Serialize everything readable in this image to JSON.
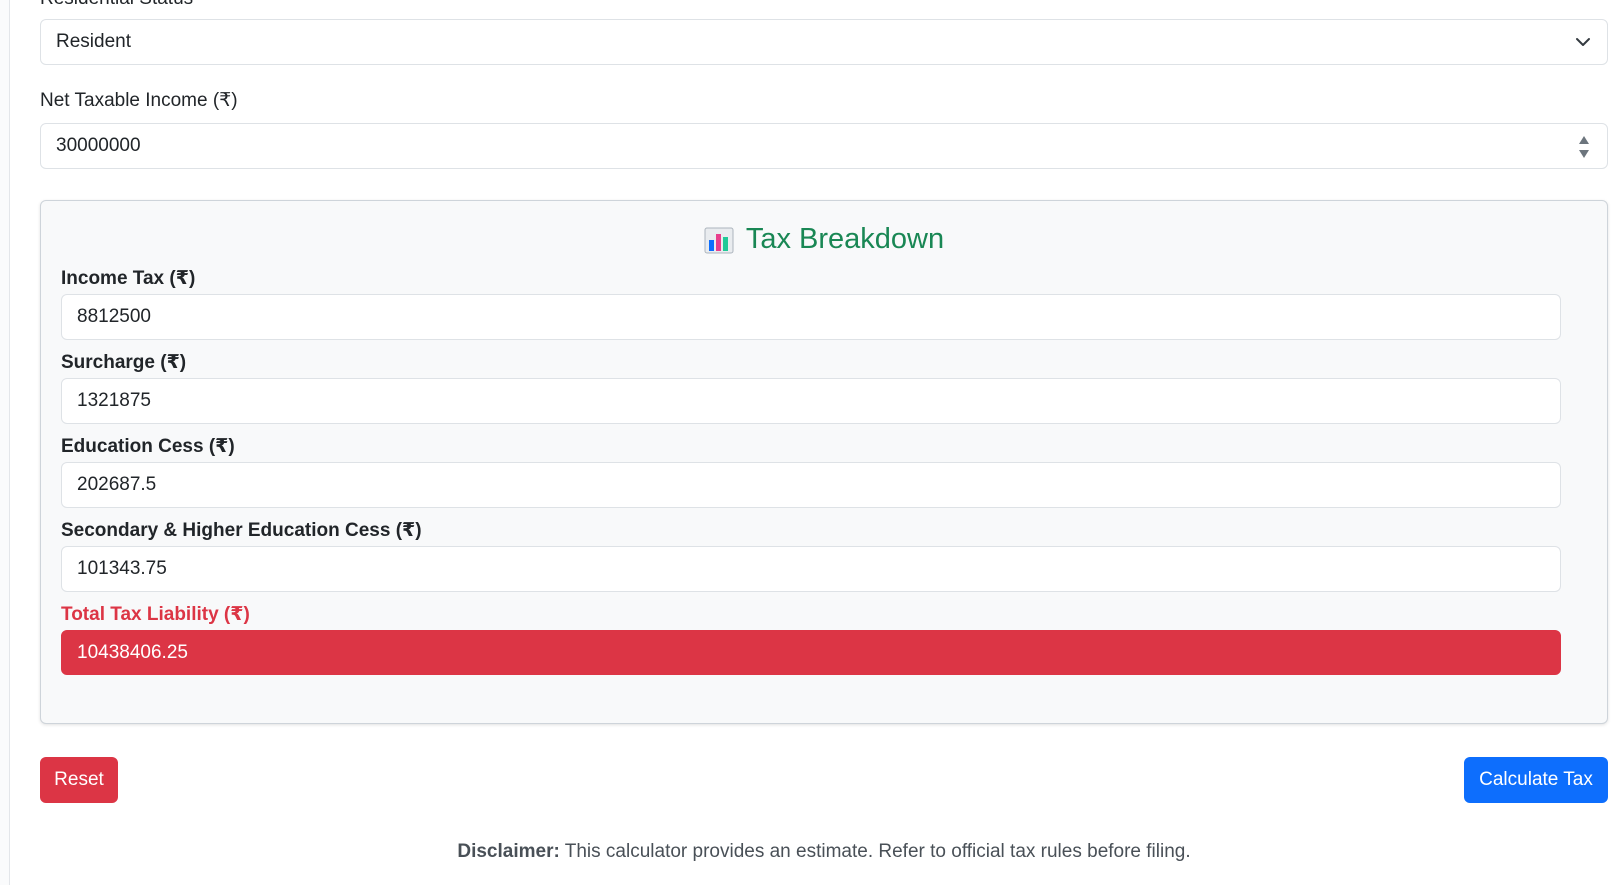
{
  "form": {
    "residential_status_label": "Residential Status",
    "residential_status_value": "Resident",
    "net_taxable_income_label": "Net Taxable Income (₹)",
    "net_taxable_income_value": "30000000"
  },
  "breakdown": {
    "title": "Tax Breakdown",
    "icon": "bar-chart-icon",
    "title_color": "#198754",
    "fields": [
      {
        "label": "Income Tax (₹)",
        "value": "8812500"
      },
      {
        "label": "Surcharge (₹)",
        "value": "1321875"
      },
      {
        "label": "Education Cess (₹)",
        "value": "202687.5"
      },
      {
        "label": "Secondary & Higher Education Cess (₹)",
        "value": "101343.75"
      }
    ],
    "total_label": "Total Tax Liability (₹)",
    "total_value": "10438406.25",
    "total_color": "#dc3545"
  },
  "actions": {
    "reset_label": "Reset",
    "calculate_label": "Calculate Tax",
    "reset_color": "#dc3545",
    "calculate_color": "#0d6efd"
  },
  "footer": {
    "disclaimer_prefix": "Disclaimer:",
    "disclaimer_text": " This calculator provides an estimate. Refer to official tax rules before filing."
  }
}
